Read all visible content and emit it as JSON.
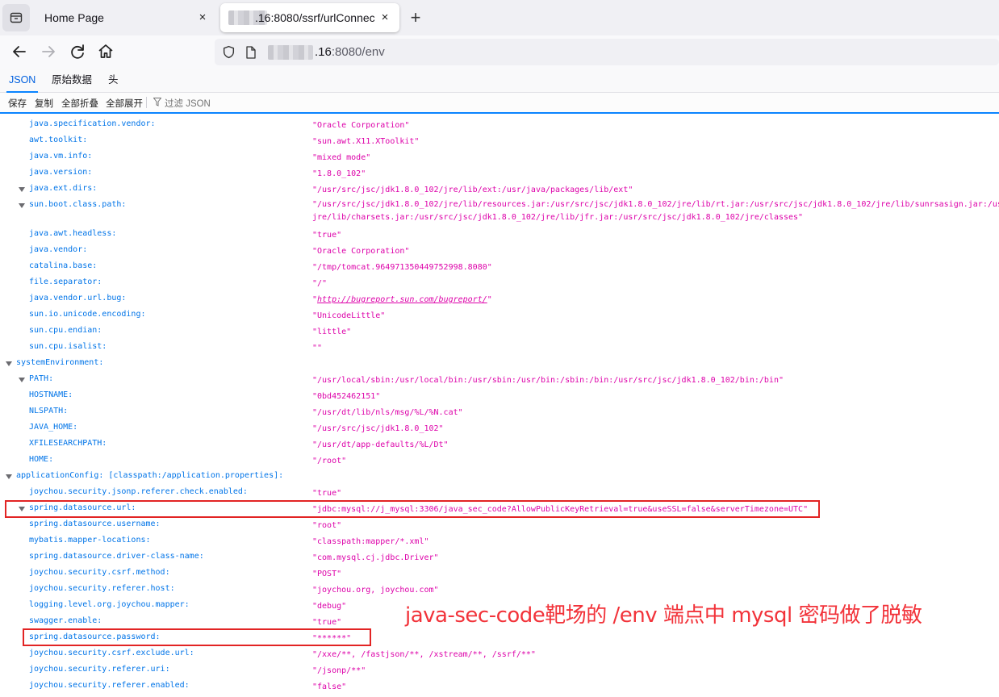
{
  "browser": {
    "tabs": [
      {
        "title": "Home Page",
        "close": "×"
      },
      {
        "title": ".16:8080/ssrf/urlConnec",
        "close": "×"
      }
    ],
    "new_tab": "+",
    "url": {
      "host": ".16",
      "path": ":8080/env"
    }
  },
  "viewer": {
    "tabs": [
      "JSON",
      "原始数据",
      "头"
    ],
    "toolbar": {
      "save": "保存",
      "copy": "复制",
      "collapse_all": "全部折叠",
      "expand_all": "全部展开",
      "filter": "过滤 JSON"
    }
  },
  "rows": [
    {
      "key": "java.specification.vendor:",
      "value": "\"Oracle Corporation\""
    },
    {
      "key": "awt.toolkit:",
      "value": "\"sun.awt.X11.XToolkit\""
    },
    {
      "key": "java.vm.info:",
      "value": "\"mixed mode\""
    },
    {
      "key": "java.version:",
      "value": "\"1.8.0_102\""
    },
    {
      "key": "java.ext.dirs:",
      "value": "\"/usr/src/jsc/jdk1.8.0_102/jre/lib/ext:/usr/java/packages/lib/ext\""
    },
    {
      "key": "sun.boot.class.path:",
      "value": "\"/usr/src/jsc/jdk1.8.0_102/jre/lib/resources.jar:/usr/src/jsc/jdk1.8.0_102/jre/lib/rt.jar:/usr/src/jsc/jdk1.8.0_102/jre/lib/sunrsasign.jar:/us",
      "value2": "jre/lib/charsets.jar:/usr/src/jsc/jdk1.8.0_102/jre/lib/jfr.jar:/usr/src/jsc/jdk1.8.0_102/jre/classes\""
    },
    {
      "key": "java.awt.headless:",
      "value": "\"true\""
    },
    {
      "key": "java.vendor:",
      "value": "\"Oracle Corporation\""
    },
    {
      "key": "catalina.base:",
      "value": "\"/tmp/tomcat.964971350449752998.8080\""
    },
    {
      "key": "file.separator:",
      "value": "\"/\""
    },
    {
      "key": "java.vendor.url.bug:",
      "value_pre": "\"",
      "link": "http://bugreport.sun.com/bugreport/",
      "value_post": "\""
    },
    {
      "key": "sun.io.unicode.encoding:",
      "value": "\"UnicodeLittle\""
    },
    {
      "key": "sun.cpu.endian:",
      "value": "\"little\""
    },
    {
      "key": "sun.cpu.isalist:",
      "value": "\"\""
    },
    {
      "key": "systemEnvironment:",
      "value": ""
    },
    {
      "key": "PATH:",
      "value": "\"/usr/local/sbin:/usr/local/bin:/usr/sbin:/usr/bin:/sbin:/bin:/usr/src/jsc/jdk1.8.0_102/bin:/bin\""
    },
    {
      "key": "HOSTNAME:",
      "value": "\"0bd452462151\""
    },
    {
      "key": "NLSPATH:",
      "value": "\"/usr/dt/lib/nls/msg/%L/%N.cat\""
    },
    {
      "key": "JAVA_HOME:",
      "value": "\"/usr/src/jsc/jdk1.8.0_102\""
    },
    {
      "key": "XFILESEARCHPATH:",
      "value": "\"/usr/dt/app-defaults/%L/Dt\""
    },
    {
      "key": "HOME:",
      "value": "\"/root\""
    },
    {
      "key": "applicationConfig: [classpath:/application.properties]:",
      "value": ""
    },
    {
      "key": "joychou.security.jsonp.referer.check.enabled:",
      "value": "\"true\""
    },
    {
      "key": "spring.datasource.url:",
      "value": "\"jdbc:mysql://j_mysql:3306/java_sec_code?AllowPublicKeyRetrieval=true&useSSL=false&serverTimezone=UTC\""
    },
    {
      "key": "spring.datasource.username:",
      "value": "\"root\""
    },
    {
      "key": "mybatis.mapper-locations:",
      "value": "\"classpath:mapper/*.xml\""
    },
    {
      "key": "spring.datasource.driver-class-name:",
      "value": "\"com.mysql.cj.jdbc.Driver\""
    },
    {
      "key": "joychou.security.csrf.method:",
      "value": "\"POST\""
    },
    {
      "key": "joychou.security.referer.host:",
      "value": "\"joychou.org, joychou.com\""
    },
    {
      "key": "logging.level.org.joychou.mapper:",
      "value": "\"debug\""
    },
    {
      "key": "swagger.enable:",
      "value": "\"true\""
    },
    {
      "key": "spring.datasource.password:",
      "value": "\"******\""
    },
    {
      "key": "joychou.security.csrf.exclude.url:",
      "value": "\"/xxe/**, /fastjson/**, /xstream/**, /ssrf/**\""
    },
    {
      "key": "joychou.security.referer.uri:",
      "value": "\"/jsonp/**\""
    },
    {
      "key": "joychou.security.referer.enabled:",
      "value": "\"false\""
    }
  ],
  "annotation": "java-sec-code靶场的 /env 端点中 mysql 密码做了脱敏"
}
